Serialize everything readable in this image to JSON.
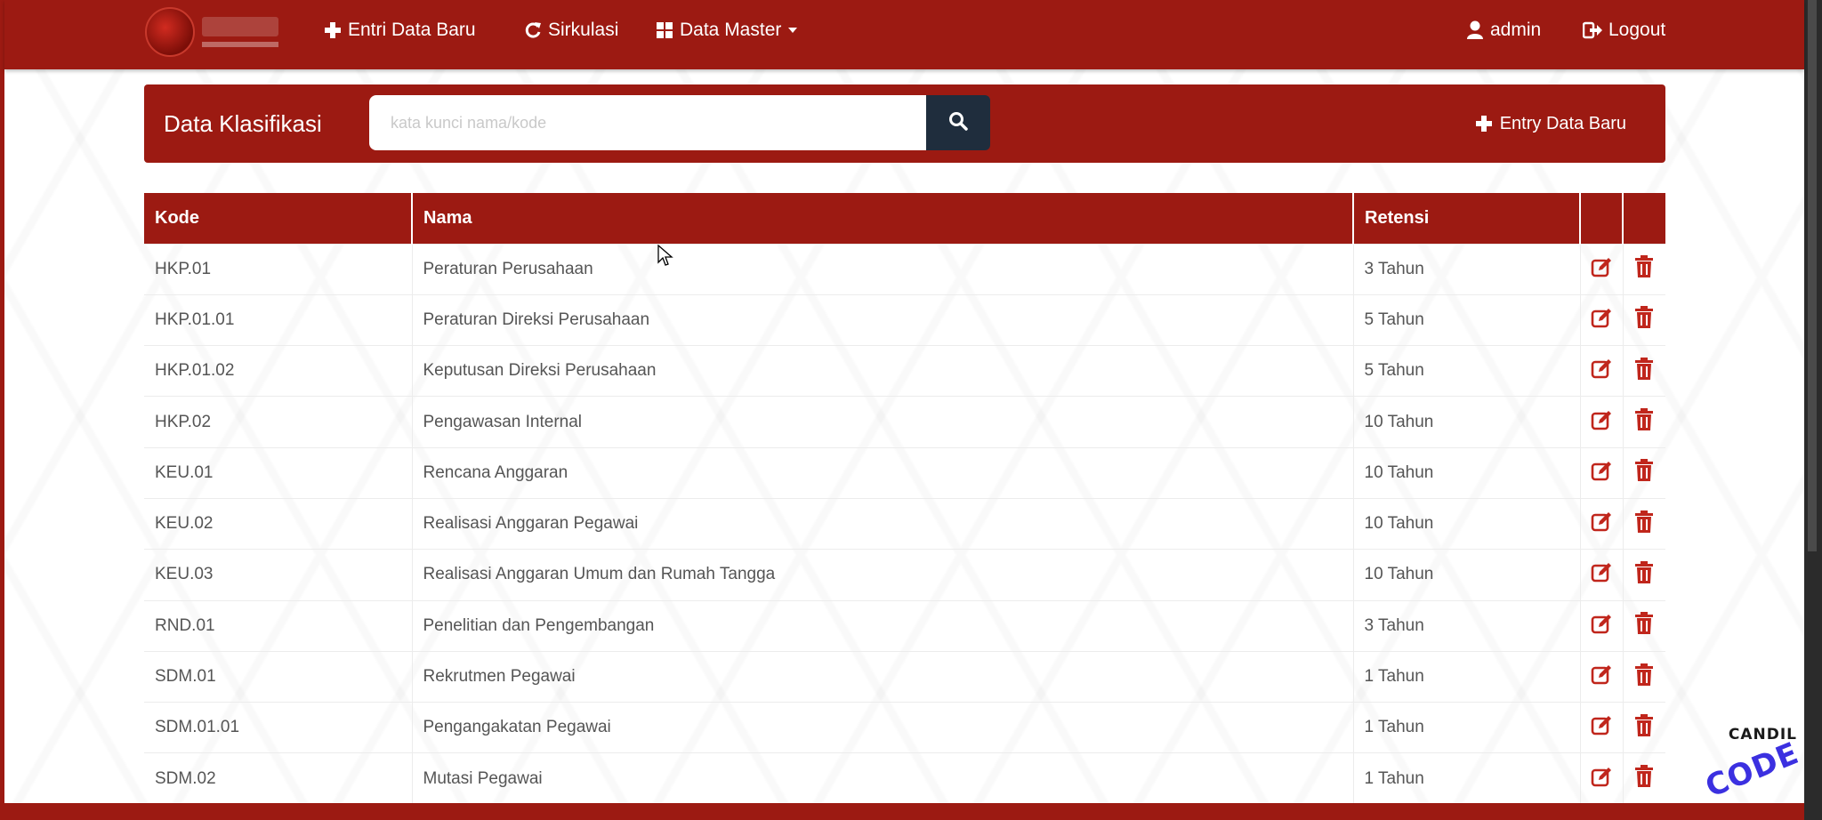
{
  "nav": {
    "entri_label": "Entri Data Baru",
    "sirkulasi_label": "Sirkulasi",
    "master_label": "Data Master",
    "user_label": "admin",
    "logout_label": "Logout"
  },
  "panel": {
    "title": "Data Klasifikasi",
    "search_placeholder": "kata kunci nama/kode",
    "search_value": "",
    "entry_label": "Entry Data Baru"
  },
  "table": {
    "headers": {
      "kode": "Kode",
      "nama": "Nama",
      "retensi": "Retensi"
    },
    "rows": [
      {
        "kode": "HKP.01",
        "nama": "Peraturan Perusahaan",
        "retensi": "3 Tahun"
      },
      {
        "kode": "HKP.01.01",
        "nama": "Peraturan Direksi Perusahaan",
        "retensi": "5 Tahun"
      },
      {
        "kode": "HKP.01.02",
        "nama": "Keputusan Direksi Perusahaan",
        "retensi": "5 Tahun"
      },
      {
        "kode": "HKP.02",
        "nama": "Pengawasan Internal",
        "retensi": "10 Tahun"
      },
      {
        "kode": "KEU.01",
        "nama": "Rencana Anggaran",
        "retensi": "10 Tahun"
      },
      {
        "kode": "KEU.02",
        "nama": "Realisasi Anggaran Pegawai",
        "retensi": "10 Tahun"
      },
      {
        "kode": "KEU.03",
        "nama": "Realisasi Anggaran Umum dan Rumah Tangga",
        "retensi": "10 Tahun"
      },
      {
        "kode": "RND.01",
        "nama": "Penelitian dan Pengembangan",
        "retensi": "3 Tahun"
      },
      {
        "kode": "SDM.01",
        "nama": "Rekrutmen Pegawai",
        "retensi": "1 Tahun"
      },
      {
        "kode": "SDM.01.01",
        "nama": "Pengangakatan Pegawai",
        "retensi": "1 Tahun"
      },
      {
        "kode": "SDM.02",
        "nama": "Mutasi Pegawai",
        "retensi": "1 Tahun"
      }
    ]
  },
  "watermark": {
    "line1": "CANDIL",
    "line2": "CODE"
  },
  "colors": {
    "primary": "#9c1a12",
    "search_button": "#1f2d3d",
    "action_icon": "#c0261c"
  },
  "icons": {
    "logo": "app-logo",
    "entri": "plus-icon",
    "sirkulasi": "refresh-icon",
    "master": "grid-icon",
    "user": "user-icon",
    "logout": "logout-icon",
    "search": "search-icon",
    "edit": "edit-icon",
    "delete": "trash-icon"
  }
}
